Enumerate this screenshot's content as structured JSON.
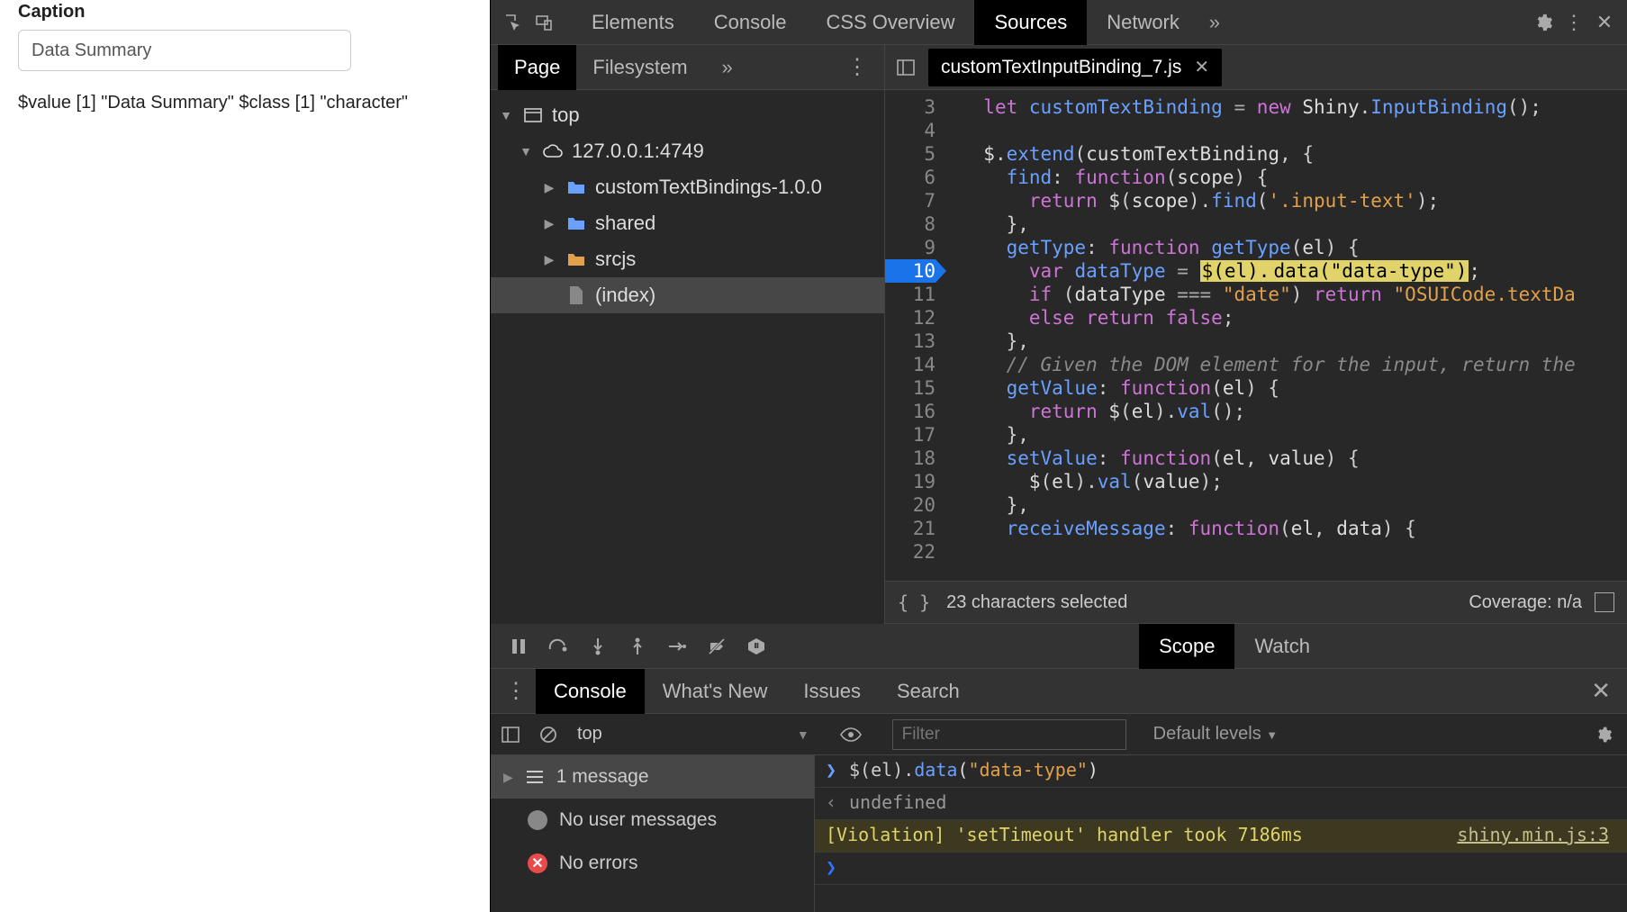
{
  "app": {
    "caption_label": "Caption",
    "caption_value": "Data Summary",
    "output": "$value [1] \"Data Summary\" $class [1] \"character\""
  },
  "devtools": {
    "top_tabs": [
      "Elements",
      "Console",
      "CSS Overview",
      "Sources",
      "Network"
    ],
    "top_active": "Sources",
    "subtabs": [
      "Page",
      "Filesystem"
    ],
    "subtab_active": "Page",
    "tree": {
      "top": "top",
      "host": "127.0.0.1:4749",
      "folders": [
        "customTextBindings-1.0.0",
        "shared",
        "srcjs"
      ],
      "index": "(index)"
    },
    "open_file": "customTextInputBinding_7.js",
    "line_start": 3,
    "breakpoint_line": 10,
    "code_lines": [
      {
        "n": 3,
        "html": "  <span class='kw'>let</span> <span class='def'>customTextBinding</span> <span class='op'>=</span> <span class='kw'>new</span> <span class='id'>Shiny</span>.<span class='fn'>InputBinding</span>();"
      },
      {
        "n": 4,
        "html": ""
      },
      {
        "n": 5,
        "html": "  <span class='id'>$</span>.<span class='fn'>extend</span>(<span class='id'>customTextBinding</span>, {"
      },
      {
        "n": 6,
        "html": "    <span class='def'>find</span>: <span class='kw'>function</span>(<span class='id'>scope</span>) {"
      },
      {
        "n": 7,
        "html": "      <span class='kw'>return</span> <span class='id'>$</span>(<span class='id'>scope</span>).<span class='fn'>find</span>(<span class='str'>'.input-text'</span>);"
      },
      {
        "n": 8,
        "html": "    },"
      },
      {
        "n": 9,
        "html": "    <span class='def'>getType</span>: <span class='kw'>function</span> <span class='fn'>getType</span>(<span class='id'>el</span>) {"
      },
      {
        "n": 10,
        "html": "      <span class='kw'>var</span> <span class='def'>dataType</span> <span class='op'>=</span> <span class='hl'>$(el).</span><span class='hl'>data(\"data-type\")</span>;"
      },
      {
        "n": 11,
        "html": "      <span class='kw'>if</span> (<span class='id'>dataType</span> <span class='op'>===</span> <span class='str'>\"date\"</span>) <span class='kw'>return</span> <span class='str'>\"OSUICode.textDa</span>"
      },
      {
        "n": 12,
        "html": "      <span class='kw'>else</span> <span class='kw'>return</span> <span class='bool'>false</span>;"
      },
      {
        "n": 13,
        "html": "    },"
      },
      {
        "n": 14,
        "html": "    <span class='cm'>// Given the DOM element for the input, return the</span>"
      },
      {
        "n": 15,
        "html": "    <span class='def'>getValue</span>: <span class='kw'>function</span>(<span class='id'>el</span>) {"
      },
      {
        "n": 16,
        "html": "      <span class='kw'>return</span> <span class='id'>$</span>(<span class='id'>el</span>).<span class='fn'>val</span>();"
      },
      {
        "n": 17,
        "html": "    },"
      },
      {
        "n": 18,
        "html": "    <span class='def'>setValue</span>: <span class='kw'>function</span>(<span class='id'>el</span>, <span class='id'>value</span>) {"
      },
      {
        "n": 19,
        "html": "      <span class='id'>$</span>(<span class='id'>el</span>).<span class='fn'>val</span>(<span class='id'>value</span>);"
      },
      {
        "n": 20,
        "html": "    },"
      },
      {
        "n": 21,
        "html": "    <span class='def'>receiveMessage</span>: <span class='kw'>function</span>(<span class='id'>el</span>, <span class='id'>data</span>) {"
      },
      {
        "n": 22,
        "html": ""
      }
    ],
    "selection_status": "23 characters selected",
    "coverage": "Coverage: n/a",
    "dbg_tabs": [
      "Scope",
      "Watch"
    ],
    "dbg_active": "Scope",
    "drawer_tabs": [
      "Console",
      "What's New",
      "Issues",
      "Search"
    ],
    "drawer_active": "Console",
    "console_context": "top",
    "filter_placeholder": "Filter",
    "levels_label": "Default levels",
    "msg_sidebar": [
      {
        "icon": "list",
        "label": "1 message",
        "sel": true
      },
      {
        "icon": "user",
        "label": "No user messages"
      },
      {
        "icon": "error",
        "label": "No errors"
      }
    ],
    "console_lines": {
      "input": "$(el).data(\"data-type\")",
      "output": "undefined",
      "violation_text": "[Violation] 'setTimeout' handler took 7186ms",
      "violation_link": "shiny.min.js:3"
    }
  }
}
